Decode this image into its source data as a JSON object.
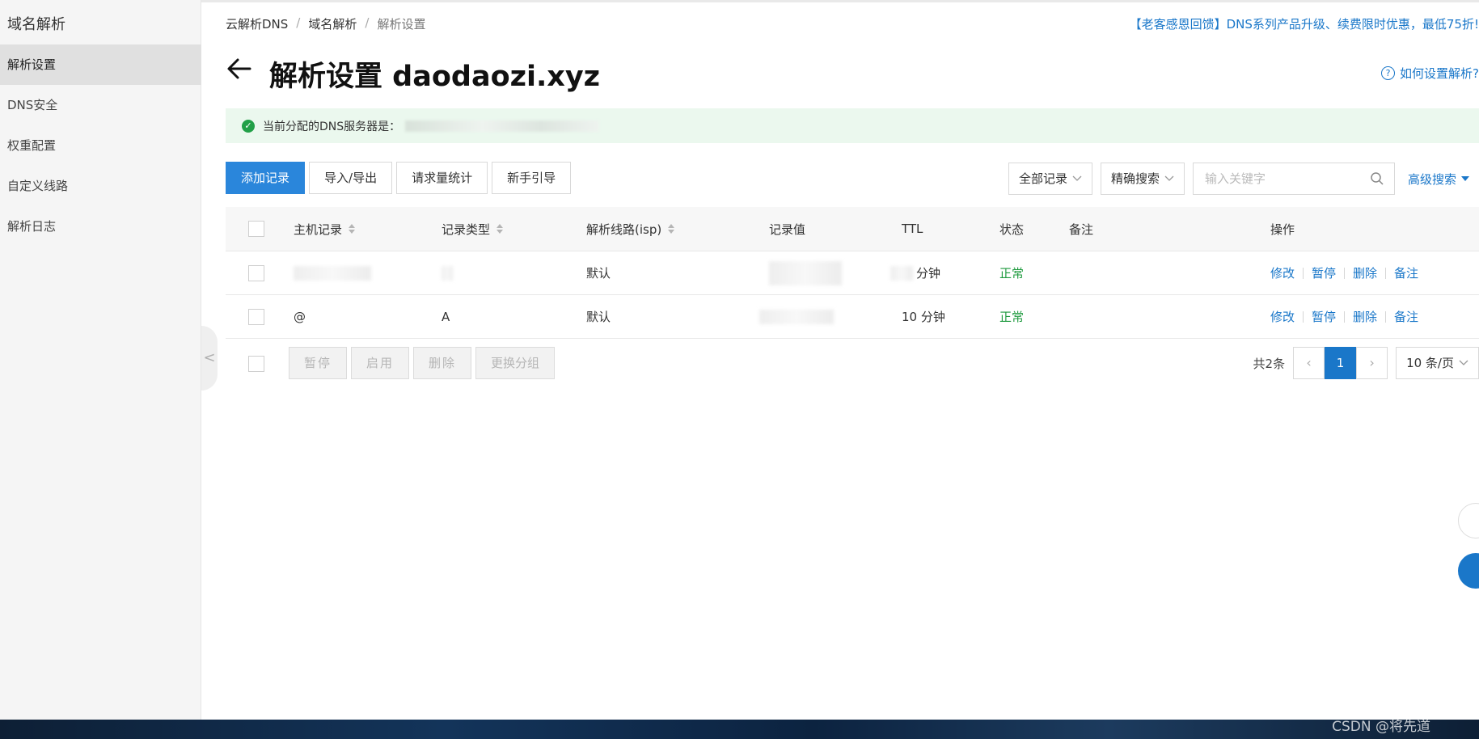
{
  "sidebar": {
    "title": "域名解析",
    "items": [
      {
        "label": "解析设置",
        "active": true
      },
      {
        "label": "DNS安全"
      },
      {
        "label": "权重配置"
      },
      {
        "label": "自定义线路"
      },
      {
        "label": "解析日志"
      }
    ],
    "collapse_glyph": "<"
  },
  "breadcrumb": {
    "items": [
      "云解析DNS",
      "域名解析",
      "解析设置"
    ],
    "separator": "/"
  },
  "promo": "【老客感恩回馈】DNS系列产品升级、续费限时优惠，最低75折!",
  "page": {
    "title": "解析设置 daodaozi.xyz",
    "help_link": "如何设置解析?"
  },
  "dns_banner": {
    "label": "当前分配的DNS服务器是："
  },
  "toolbar": {
    "add": "添加记录",
    "import_export": "导入/导出",
    "stats": "请求量统计",
    "guide": "新手引导"
  },
  "filters": {
    "record_filter": "全部记录",
    "search_mode": "精确搜索",
    "search_placeholder": "输入关键字",
    "advanced": "高级搜索"
  },
  "table": {
    "headers": {
      "host": "主机记录",
      "type": "记录类型",
      "line": "解析线路(isp)",
      "value": "记录值",
      "ttl": "TTL",
      "status": "状态",
      "remark": "备注",
      "actions": "操作"
    },
    "rows": [
      {
        "host": "",
        "type": "",
        "line": "默认",
        "value": "",
        "ttl": "分钟",
        "status": "正常"
      },
      {
        "host": "@",
        "type": "A",
        "line": "默认",
        "value": "",
        "ttl": "10 分钟",
        "status": "正常"
      }
    ],
    "row_actions": [
      "修改",
      "暂停",
      "删除",
      "备注"
    ]
  },
  "bulk": {
    "pause": "暂停",
    "enable": "启用",
    "delete": "删除",
    "change_group": "更换分组"
  },
  "pagination": {
    "total": "共2条",
    "current": "1",
    "page_size": "10 条/页"
  },
  "colors": {
    "primary": "#2a86db",
    "link": "#1a77c9",
    "success": "#1e9a3e",
    "banner_bg": "#ebf8ee"
  },
  "watermark": "CSDN @将先道"
}
